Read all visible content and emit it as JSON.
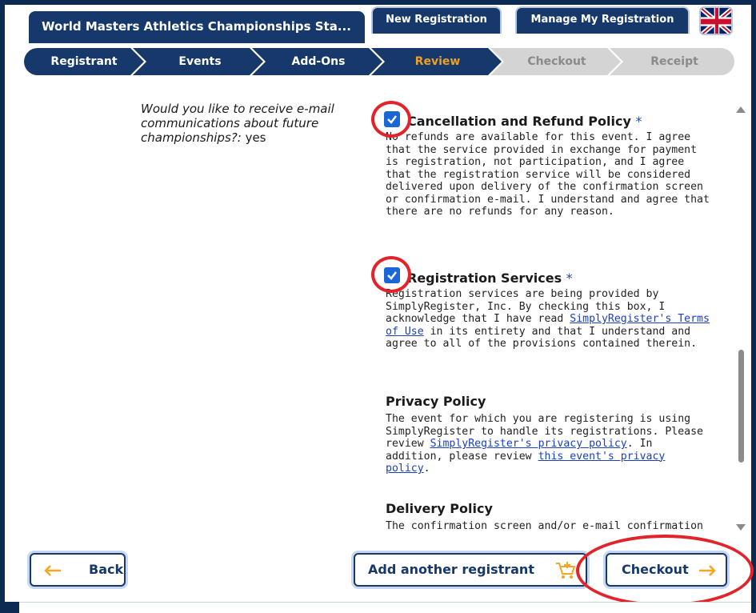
{
  "header": {
    "title": "World Masters Athletics Championships Sta...",
    "tabs": [
      {
        "label": "New Registration"
      },
      {
        "label": "Manage My Registration"
      }
    ],
    "flag": "uk-flag-icon"
  },
  "steps": [
    {
      "label": "Registrant",
      "state": "done"
    },
    {
      "label": "Events",
      "state": "done"
    },
    {
      "label": "Add-Ons",
      "state": "done"
    },
    {
      "label": "Review",
      "state": "current"
    },
    {
      "label": "Checkout",
      "state": "upcoming"
    },
    {
      "label": "Receipt",
      "state": "upcoming"
    }
  ],
  "left": {
    "question": "Would you like to receive e-mail communications about future championships?:",
    "answer": "yes"
  },
  "policies": {
    "cancellation": {
      "title": "Cancellation and Refund Policy",
      "required": "*",
      "text": "No refunds are available for this event. I agree that the service provided in exchange for payment is registration, not participation, and I agree that the registration service will be considered delivered upon delivery of the confirmation screen or confirmation e-mail. I understand and agree that there are no refunds for any reason.",
      "checked": true
    },
    "registration_services": {
      "title": "Registration Services",
      "required": "*",
      "text_before": "Registration services are being provided by SimplyRegister, Inc. By checking this box, I acknowledge that I have read",
      "link": "SimplyRegister's Terms of Use",
      "text_after": "in its entirety and that I understand and agree to all of the provisions contained therein.",
      "checked": true
    },
    "privacy": {
      "title": "Privacy Policy",
      "text_before": "The event for which you are registering is using SimplyRegister to handle its registrations. Please review",
      "link1": "SimplyRegister's privacy policy",
      "text_middle": ". In addition, please review",
      "link2": "this event's privacy policy",
      "text_after": "."
    },
    "delivery": {
      "title": "Delivery Policy",
      "text": "The confirmation screen and/or e-mail confirmation"
    }
  },
  "buttons": {
    "back": "Back",
    "add_registrant": "Add another registrant",
    "checkout": "Checkout"
  },
  "colors": {
    "navy": "#16386a",
    "review_orange": "#f0a020",
    "annotation_red": "#e3232a",
    "checkbox_blue": "#1a66d6",
    "button_arrow_orange": "#f5a623"
  }
}
